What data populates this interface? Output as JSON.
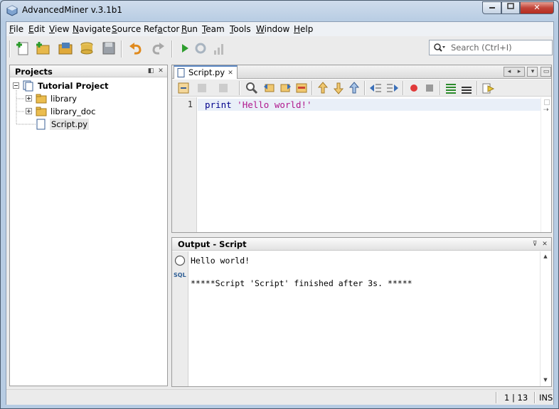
{
  "window": {
    "title": "AdvancedMiner v.3.1b1",
    "close_label": "✕"
  },
  "menu": [
    "File",
    "Edit",
    "View",
    "Navigate",
    "Source",
    "Refactor",
    "Run",
    "Team",
    "Tools",
    "Window",
    "Help"
  ],
  "search": {
    "placeholder": "Search (Ctrl+I)"
  },
  "projects": {
    "title": "Projects",
    "root": "Tutorial Project",
    "items": [
      "library",
      "library_doc",
      "Script.py"
    ]
  },
  "editor": {
    "tab_label": "Script.py",
    "line_number": "1",
    "code_keyword": "print",
    "code_string": "'Hello world!'"
  },
  "output": {
    "title": "Output - Script",
    "lines": [
      "Hello world!",
      "",
      "*****Script 'Script' finished after 3s. *****"
    ],
    "sql_label": "SQL"
  },
  "status": {
    "position": "1 | 13",
    "mode": "INS"
  }
}
